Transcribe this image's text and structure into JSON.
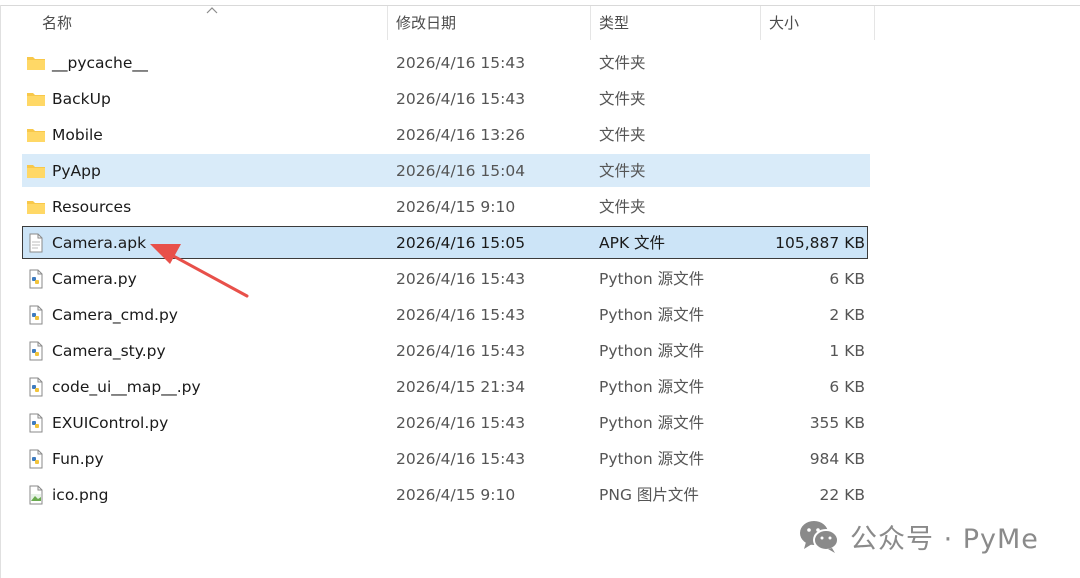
{
  "columns": {
    "name": "名称",
    "modified": "修改日期",
    "type": "类型",
    "size": "大小"
  },
  "files": [
    {
      "name": "__pycache__",
      "modified": "2026/4/16 15:43",
      "type": "文件夹",
      "size": "",
      "icon": "folder-icon",
      "state": ""
    },
    {
      "name": "BackUp",
      "modified": "2026/4/16 15:43",
      "type": "文件夹",
      "size": "",
      "icon": "folder-icon",
      "state": ""
    },
    {
      "name": "Mobile",
      "modified": "2026/4/16 13:26",
      "type": "文件夹",
      "size": "",
      "icon": "folder-icon",
      "state": ""
    },
    {
      "name": "PyApp",
      "modified": "2026/4/16 15:04",
      "type": "文件夹",
      "size": "",
      "icon": "folder-icon",
      "state": "hover"
    },
    {
      "name": "Resources",
      "modified": "2026/4/15 9:10",
      "type": "文件夹",
      "size": "",
      "icon": "folder-icon",
      "state": ""
    },
    {
      "name": "Camera.apk",
      "modified": "2026/4/16 15:05",
      "type": "APK 文件",
      "size": "105,887 KB",
      "icon": "file-icon",
      "state": "selected"
    },
    {
      "name": "Camera.py",
      "modified": "2026/4/16 15:43",
      "type": "Python 源文件",
      "size": "6 KB",
      "icon": "python-file-icon",
      "state": ""
    },
    {
      "name": "Camera_cmd.py",
      "modified": "2026/4/16 15:43",
      "type": "Python 源文件",
      "size": "2 KB",
      "icon": "python-file-icon",
      "state": ""
    },
    {
      "name": "Camera_sty.py",
      "modified": "2026/4/16 15:43",
      "type": "Python 源文件",
      "size": "1 KB",
      "icon": "python-file-icon",
      "state": ""
    },
    {
      "name": "code_ui__map__.py",
      "modified": "2026/4/15 21:34",
      "type": "Python 源文件",
      "size": "6 KB",
      "icon": "python-file-icon",
      "state": ""
    },
    {
      "name": "EXUIControl.py",
      "modified": "2026/4/16 15:43",
      "type": "Python 源文件",
      "size": "355 KB",
      "icon": "python-file-icon",
      "state": ""
    },
    {
      "name": "Fun.py",
      "modified": "2026/4/16 15:43",
      "type": "Python 源文件",
      "size": "984 KB",
      "icon": "python-file-icon",
      "state": ""
    },
    {
      "name": "ico.png",
      "modified": "2026/4/15 9:10",
      "type": "PNG 图片文件",
      "size": "22 KB",
      "icon": "image-file-icon",
      "state": ""
    }
  ],
  "watermark": {
    "text": "公众号 · PyMe",
    "icon": "wechat-icon"
  },
  "colors": {
    "selected_bg": "#cce4f7",
    "hover_bg": "#d9ebf9",
    "folder": "#f8c84a",
    "arrow": "#e8504a"
  }
}
